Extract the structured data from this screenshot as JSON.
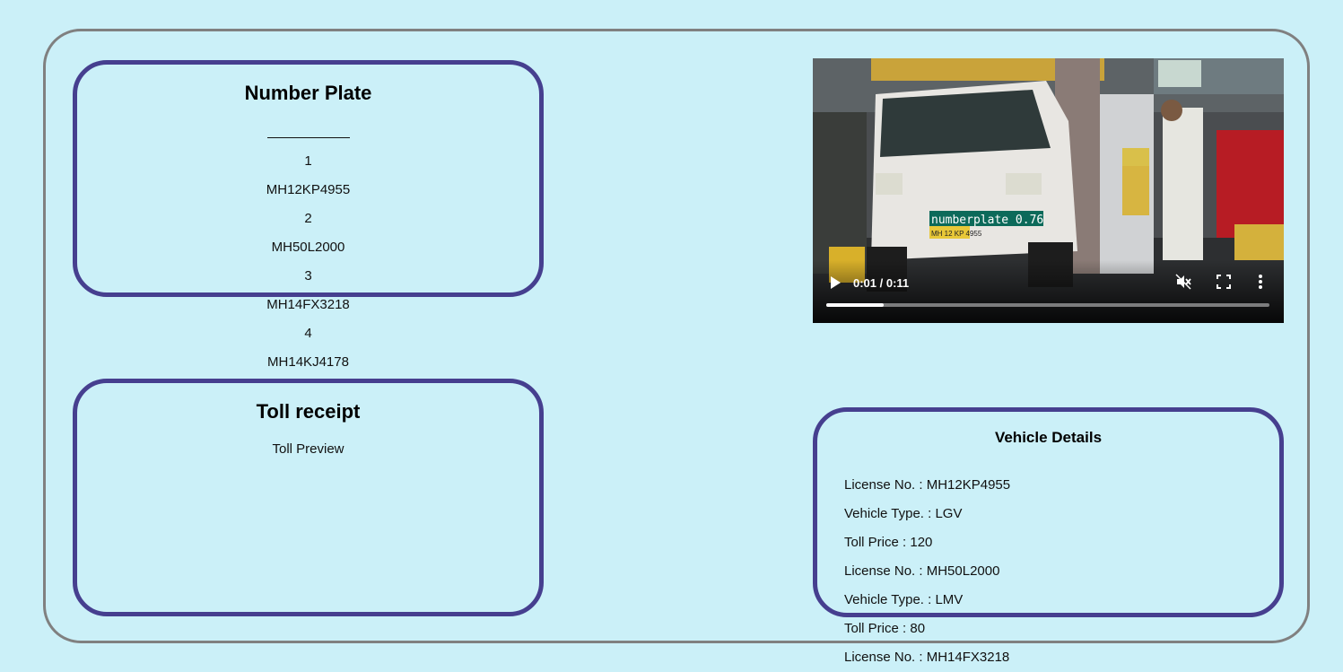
{
  "number_plate": {
    "title": "Number Plate",
    "items": [
      "1",
      "MH12KP4955",
      "2",
      "MH50L2000",
      "3",
      "MH14FX3218",
      "4",
      "MH14KJ4178"
    ]
  },
  "toll_receipt": {
    "title": "Toll receipt",
    "preview_label": "Toll Preview"
  },
  "video": {
    "time": "0:01 / 0:11",
    "progress": 0.13,
    "detection_label": "numberplate 0.76",
    "plate_text": "MH 12 KP 4955",
    "icons": [
      "play-icon",
      "mute-icon",
      "fullscreen-icon",
      "more-vert-icon"
    ]
  },
  "vehicle_details": {
    "title": "Vehicle Details",
    "items": [
      "License No. : MH12KP4955",
      "Vehicle Type. : LGV",
      "Toll Price : 120",
      "License No. : MH50L2000",
      "Vehicle Type. : LMV",
      "Toll Price : 80",
      "License No. : MH14FX3218"
    ]
  },
  "colors": {
    "background": "#cbf0f8",
    "card_border": "#463f8f",
    "outer_border": "#808080"
  }
}
